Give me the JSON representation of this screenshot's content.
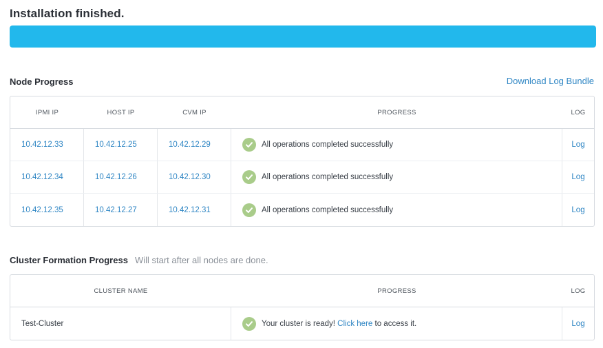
{
  "page": {
    "title": "Installation finished.",
    "progress_fraction": 1.0
  },
  "node_progress": {
    "title": "Node Progress",
    "download_link": "Download Log Bundle",
    "headers": {
      "ipmi": "IPMI IP",
      "host": "HOST IP",
      "cvm": "CVM IP",
      "progress": "PROGRESS",
      "log": "LOG"
    },
    "rows": [
      {
        "ipmi": "10.42.12.33",
        "host": "10.42.12.25",
        "cvm": "10.42.12.29",
        "status": "All operations completed successfully",
        "log": "Log"
      },
      {
        "ipmi": "10.42.12.34",
        "host": "10.42.12.26",
        "cvm": "10.42.12.30",
        "status": "All operations completed successfully",
        "log": "Log"
      },
      {
        "ipmi": "10.42.12.35",
        "host": "10.42.12.27",
        "cvm": "10.42.12.31",
        "status": "All operations completed successfully",
        "log": "Log"
      }
    ]
  },
  "cluster": {
    "title": "Cluster Formation Progress",
    "subtitle": "Will start after all nodes are done.",
    "headers": {
      "name": "CLUSTER NAME",
      "progress": "PROGRESS",
      "log": "LOG"
    },
    "row": {
      "name": "Test-Cluster",
      "status_prefix": "Your cluster is ready!",
      "status_link": "Click here",
      "status_suffix": "to access it.",
      "log": "Log"
    }
  },
  "colors": {
    "progress_bar": "#22b8ec",
    "link": "#2f86c4",
    "success_check": "#a9cc8a"
  },
  "icons": {
    "status": "check-circle-icon"
  }
}
